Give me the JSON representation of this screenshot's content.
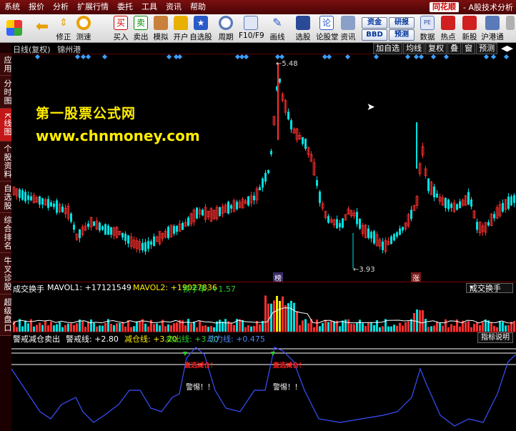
{
  "menu": [
    "系统",
    "报价",
    "分析",
    "扩展行情",
    "委托",
    "工具",
    "资讯",
    "帮助"
  ],
  "brand": {
    "logo": "同花顺",
    "subtitle": "- A股技术分析"
  },
  "toolbar": {
    "buttons": [
      "修正",
      "测速",
      "买入",
      "卖出",
      "模拟",
      "开户",
      "自选股",
      "周期",
      "F10/F9",
      "画线",
      "选股",
      "论股堂",
      "资讯",
      "数据",
      "热点",
      "新股",
      "沪港通"
    ],
    "small_buttons": [
      "资金",
      "BBD",
      "研报",
      "预测"
    ]
  },
  "sidebar": [
    "应用",
    "分时图",
    "K线图",
    "个股资料",
    "自选股",
    "综合排名",
    "牛叉诊股",
    "超级盘口"
  ],
  "chart": {
    "header_title": "日线(复权)",
    "stock_name": "锦州港",
    "header_buttons": [
      "加自选",
      "均线",
      "复权",
      "叠",
      "窗",
      "预测"
    ],
    "high_label": "5.48",
    "low_label": "3.93",
    "marker_bang": "榜",
    "marker_zhang": "涨"
  },
  "watermark": {
    "line1": "第一股票公式网",
    "line2": "www.chnmoney.com"
  },
  "volume": {
    "title": "成交换手",
    "mavol1": "MAVOL1: +17121549",
    "mavol2": "MAVOL2: +19027836",
    "turnover": "换手率: +1.57",
    "selector": "成交换手"
  },
  "indicator": {
    "title": "警戒减仓卖出",
    "warn_line": "警戒线: +2.80",
    "reduce_line": "减仓线: +3.20",
    "sell_line": "卖出线: +3.50",
    "power_line": "动力线: +0.475",
    "help_button": "指标说明",
    "alert1": "警惕！！",
    "alert2": "警惕！！",
    "red1": "直选减仓！",
    "red2": "直选减仓！"
  },
  "colors": {
    "up": "#ff3030",
    "down": "#00e0e0",
    "accent": "#ffee00",
    "diamond": "#3aa0ff"
  }
}
